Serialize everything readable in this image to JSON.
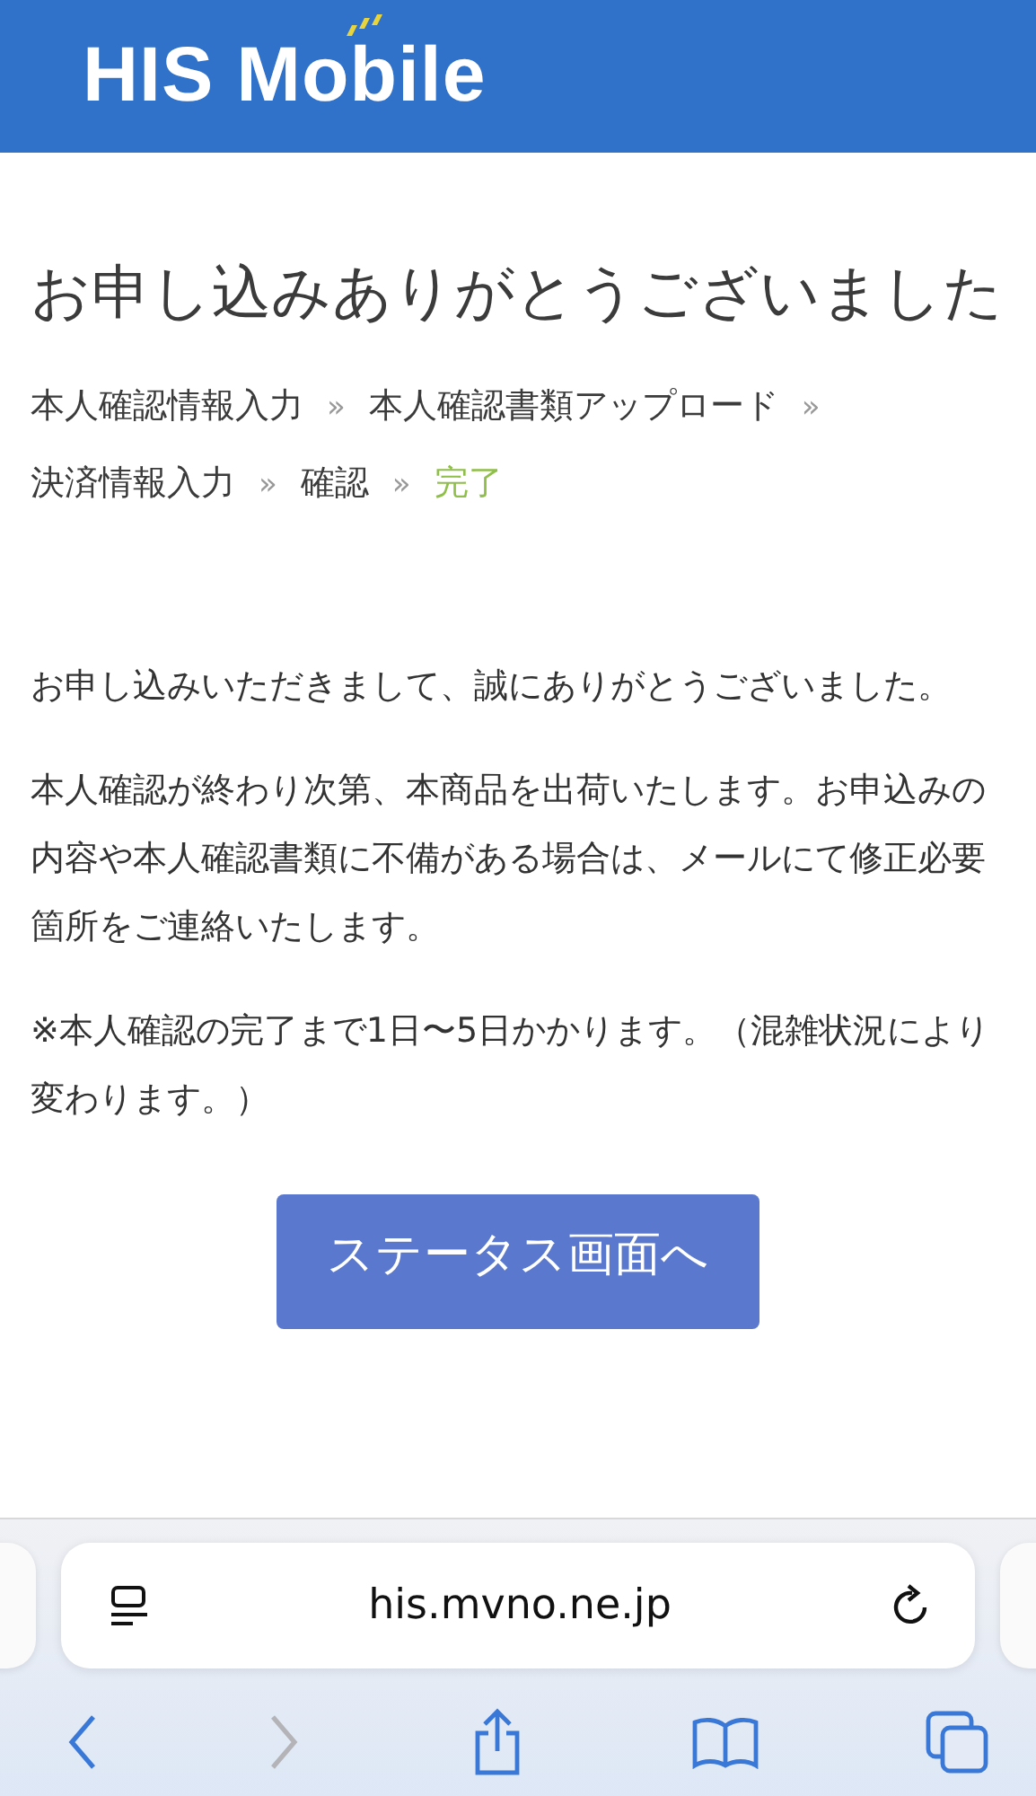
{
  "header": {
    "logo": "HIS Mobile"
  },
  "title": "お申し込みありがとうございました",
  "steps": [
    {
      "label": "本人確認情報入力",
      "separator": "»",
      "selected": false
    },
    {
      "label": "本人確認書類アップロード",
      "separator": "»",
      "selected": false
    },
    {
      "label": "決済情報入力",
      "separator": "»",
      "selected": false
    },
    {
      "label": "確認",
      "separator": "»",
      "selected": false
    },
    {
      "label": "完了",
      "selected": true
    }
  ],
  "paragraphs": [
    "お申し込みいただきまして、誠にありがとうございました。",
    "本人確認が終わり次第、本商品を出荷いたします。お申込みの内容や本人確認書類に不備がある場合は、メールにて修正必要箇所をご連絡いたします。",
    "※本人確認の完了まで1日〜5日かかります。（混雑状況により変わります。）"
  ],
  "button": "ステータス画面へ",
  "browser": {
    "url": "his.mvno.ne.jp",
    "back_disabled": false,
    "forward_disabled": true
  }
}
